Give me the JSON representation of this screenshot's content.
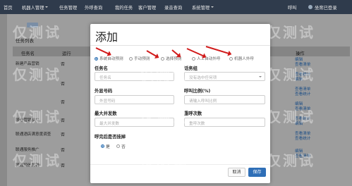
{
  "topnav": {
    "items": [
      {
        "label": "首页",
        "dropdown": false
      },
      {
        "label": "机器人管理",
        "dropdown": true
      },
      {
        "label": "任务管理",
        "dropdown": false
      },
      {
        "label": "外呼查询",
        "dropdown": false
      },
      {
        "label": "我的任务",
        "dropdown": false
      },
      {
        "label": "客户管理",
        "dropdown": false
      },
      {
        "label": "录音查询",
        "dropdown": false
      },
      {
        "label": "系统管理",
        "dropdown": true
      }
    ],
    "call_label": "呼叫",
    "status_label": "坐席已登录"
  },
  "background": {
    "list_title": "任务列表",
    "columns": [
      "任务名",
      "运行",
      "操作"
    ],
    "rows": [
      {
        "name": "新建产品营销",
        "status": "否",
        "actions": [
          "编辑",
          "查看清单"
        ]
      },
      {
        "name": "",
        "status": "否",
        "actions": [
          "查看统计",
          "编辑"
        ]
      },
      {
        "name": "",
        "status": "否",
        "actions": [
          "查看清单",
          "查看统计"
        ]
      },
      {
        "name": "联通营销推广",
        "status": "否",
        "actions": [
          "编辑",
          "查看清单"
        ]
      },
      {
        "name": "联通酒店满意度调查",
        "status": "否",
        "actions": [
          "查看统计",
          "编辑"
        ]
      },
      {
        "name": "联通服务推广",
        "status": "否",
        "actions": [
          "查看清单",
          "查看统计"
        ]
      },
      {
        "name": "联通短信营销",
        "status": "否",
        "actions": [
          "编辑",
          "查看清单"
        ]
      }
    ]
  },
  "watermark": "仅测试",
  "modal": {
    "title": "添加",
    "call_types": [
      {
        "label": "系统自动预测",
        "checked": true
      },
      {
        "label": "手动预测",
        "checked": false
      },
      {
        "label": "选择预测",
        "checked": false
      },
      {
        "label": "人工自动外呼",
        "checked": false
      },
      {
        "label": "机器人外呼",
        "checked": false
      }
    ],
    "task_name": {
      "label": "任务名",
      "placeholder": "任务名"
    },
    "task_group": {
      "label": "话务组",
      "placeholder": "没有选中任何项"
    },
    "caller_number": {
      "label": "外显号码",
      "placeholder": "外显号码"
    },
    "call_ratio": {
      "label": "呼叫比例(%)",
      "placeholder": "请输入呼叫比例"
    },
    "max_concurrency": {
      "label": "最大并发数",
      "placeholder": "最大并发数"
    },
    "retry_times": {
      "label": "重呼次数",
      "placeholder": "重呼次数"
    },
    "hangup_switch": {
      "label": "呼完后是否挂掉",
      "options": [
        {
          "label": "是",
          "checked": true
        },
        {
          "label": "否",
          "checked": false
        }
      ]
    },
    "cancel_label": "取消",
    "save_label": "保存"
  }
}
